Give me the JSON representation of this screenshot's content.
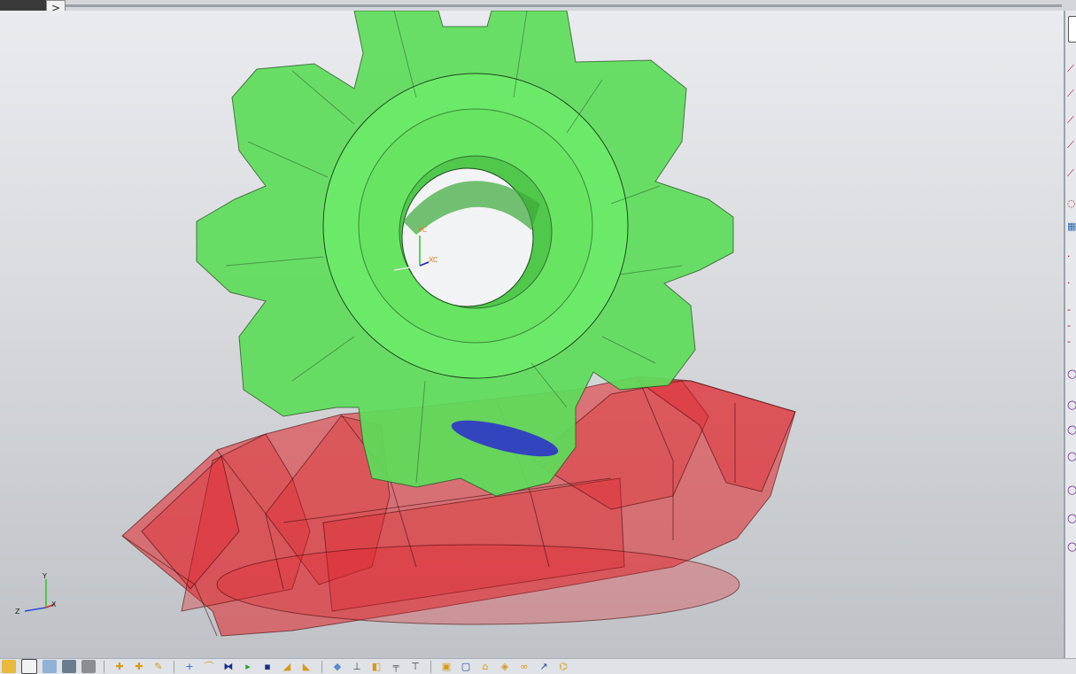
{
  "topbar": {
    "expand_label": ">"
  },
  "viewport": {
    "csys_label_yc": "YC",
    "csys_label_xc": "XC",
    "triad_y": "Y",
    "triad_z": "Z",
    "triad_x": "X"
  },
  "colors": {
    "gear_green": "#5ddc5a",
    "rack_red": "#e0242a",
    "contact_blue": "#2a2ad0"
  },
  "bottom_toolbar": {
    "icons": [
      "folder-icon",
      "window-icon",
      "cube-view-icon",
      "camera-icon",
      "render-icon",
      "new-part-icon",
      "add-component-icon",
      "sketch-icon",
      "add-point-icon",
      "curve-icon",
      "mirror-icon",
      "move-icon",
      "save-icon",
      "extrude-icon",
      "pocket-icon",
      "block-icon",
      "measure-icon",
      "section-icon",
      "align-icon",
      "pin-icon",
      "box-icon",
      "frame-icon",
      "lock-icon",
      "shaded-icon",
      "link-icon",
      "arrow-icon",
      "tree-icon"
    ]
  },
  "right_palette": {
    "icons": [
      "line-icon",
      "line-icon",
      "line-icon",
      "line-icon",
      "line-icon",
      "ellipse-icon",
      "grid-icon",
      "point-icon",
      "point-icon",
      "dash-icon",
      "dash-icon",
      "dash-icon",
      "circle-icon",
      "circle-icon",
      "circle-icon",
      "circle-icon",
      "circle-icon",
      "circle-icon",
      "circle-icon"
    ]
  }
}
